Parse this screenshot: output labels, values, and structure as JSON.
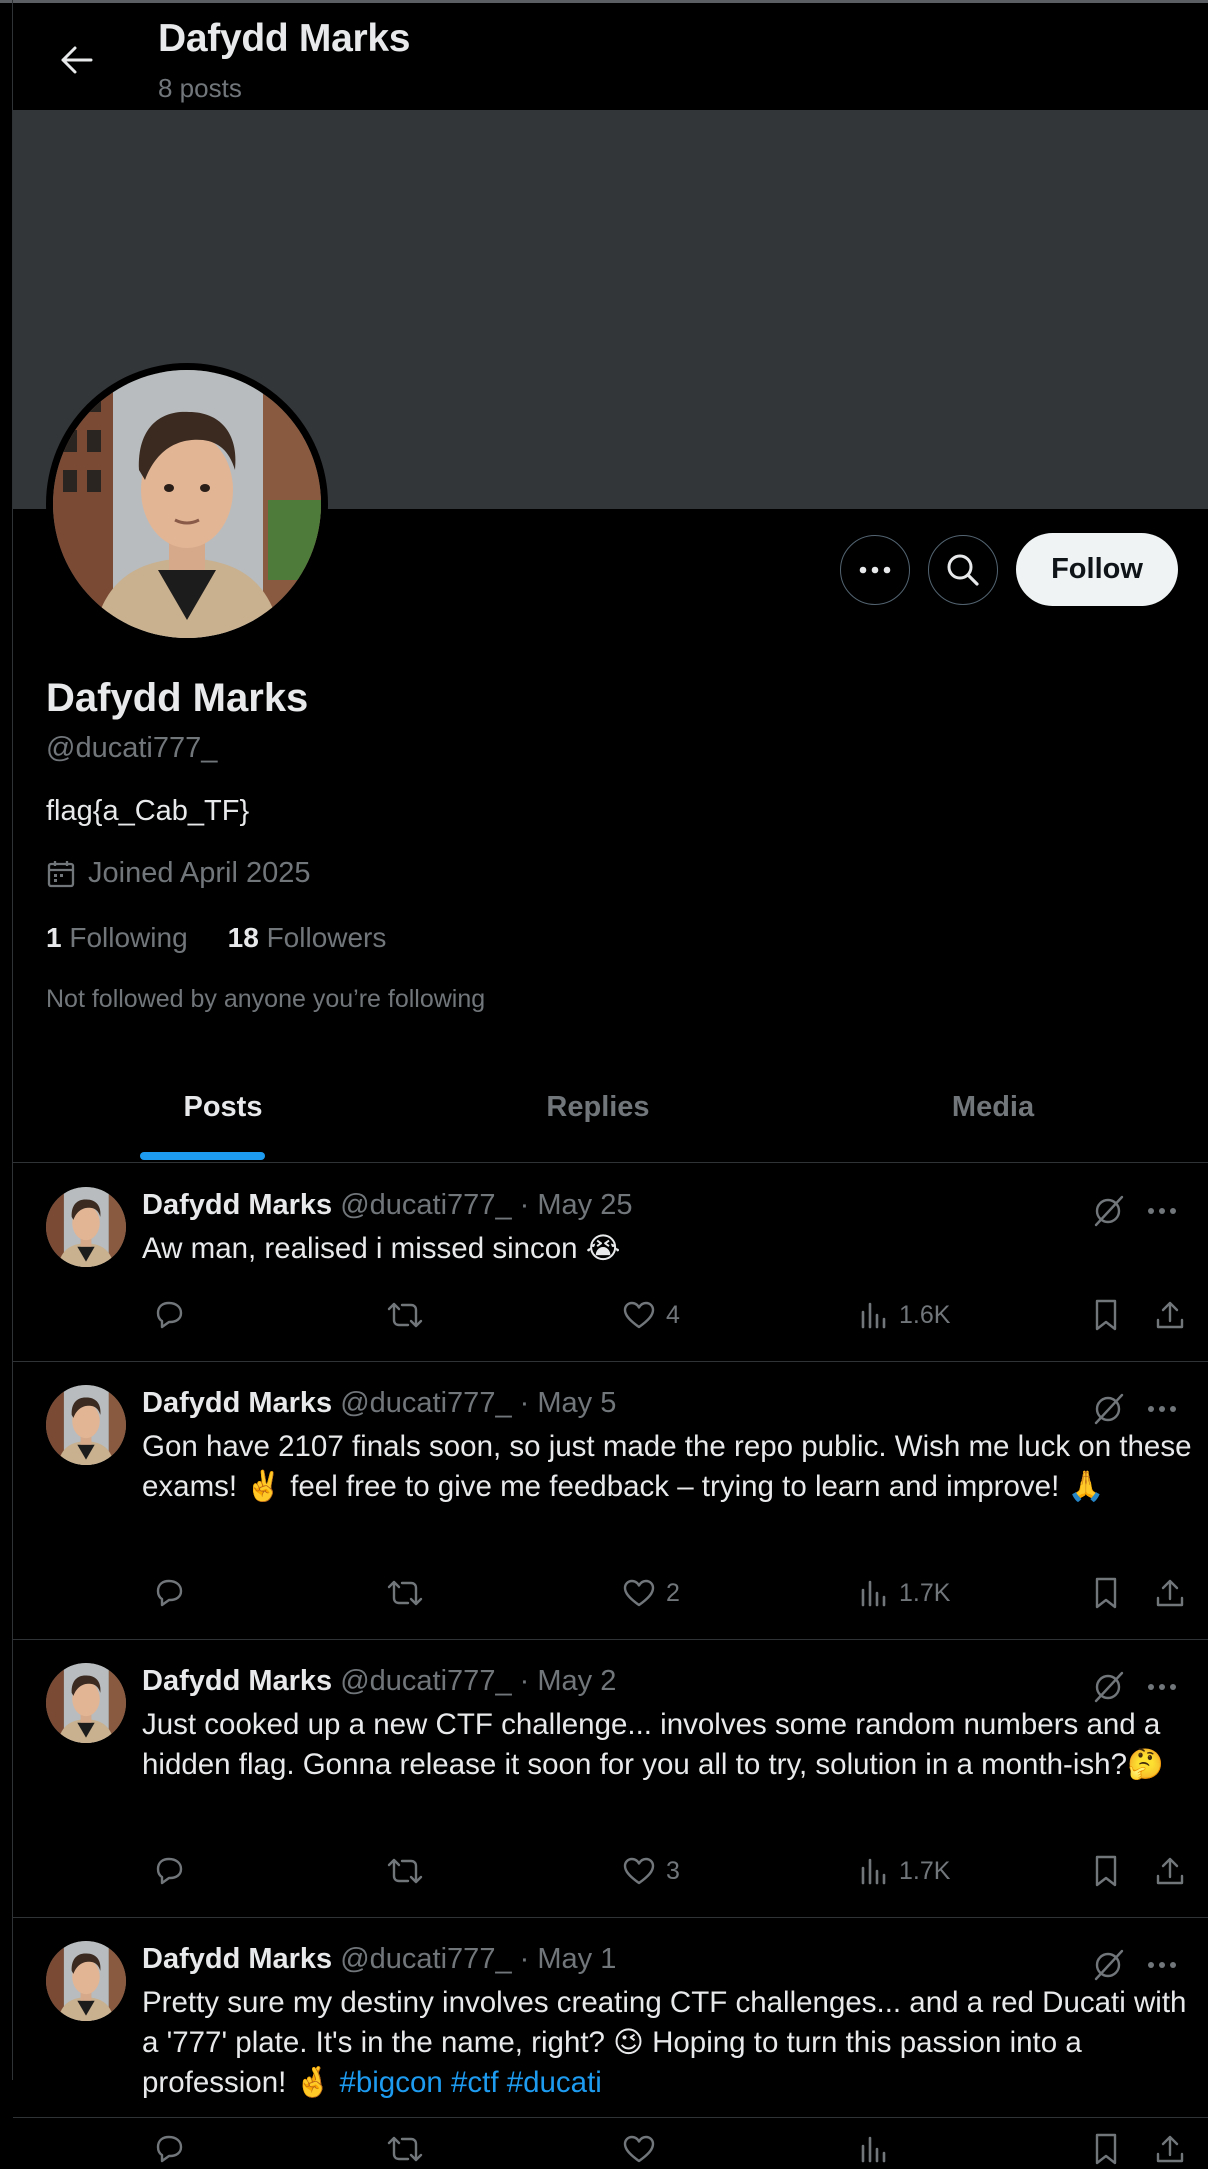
{
  "header": {
    "title": "Dafydd Marks",
    "post_count": "8 posts"
  },
  "profile": {
    "name": "Dafydd Marks",
    "handle": "@ducati777_",
    "bio": "flag{a_Cab_TF}",
    "joined": "Joined April 2025",
    "following_count": "1",
    "following_label": "Following",
    "followers_count": "18",
    "followers_label": "Followers",
    "note": "Not followed by anyone you’re following",
    "follow_label": "Follow"
  },
  "tabs": [
    {
      "label": "Posts",
      "active": true
    },
    {
      "label": "Replies",
      "active": false
    },
    {
      "label": "Media",
      "active": false
    }
  ],
  "posts": [
    {
      "name": "Dafydd Marks",
      "handle": "@ducati777_",
      "date": "May 25",
      "text": "Aw man, realised i missed sincon 😭",
      "replies": "",
      "reposts": "",
      "likes": "4",
      "views": "1.6K"
    },
    {
      "name": "Dafydd Marks",
      "handle": "@ducati777_",
      "date": "May 5",
      "text": "Gon have 2107 finals soon, so just made the repo public. Wish me luck on these exams! ✌️ feel free to give me feedback – trying to learn and improve! 🙏",
      "replies": "",
      "reposts": "",
      "likes": "2",
      "views": "1.7K"
    },
    {
      "name": "Dafydd Marks",
      "handle": "@ducati777_",
      "date": "May 2",
      "text": "Just cooked up a new CTF challenge... involves some random numbers and a hidden flag. Gonna release it soon for you all to try, solution in a month-ish?🤔",
      "replies": "",
      "reposts": "",
      "likes": "3",
      "views": "1.7K"
    },
    {
      "name": "Dafydd Marks",
      "handle": "@ducati777_",
      "date": "May 1",
      "text": "Pretty sure my destiny involves creating CTF challenges... and a red Ducati with a '777' plate. It's in the name, right? 😉 Hoping to turn this passion into",
      "text_tail": "a profession! 🤞",
      "hashtags": "#bigcon #ctf #ducati",
      "replies": "",
      "reposts": "",
      "likes": "",
      "views": ""
    }
  ],
  "colors": {
    "background": "#000000",
    "banner": "#333639",
    "accent": "#1d9bf0",
    "muted": "#71767b",
    "text": "#e7e9ea"
  },
  "icons": [
    "back-arrow-icon",
    "more-icon",
    "search-icon",
    "calendar-icon",
    "grok-icon",
    "reply-icon",
    "repost-icon",
    "like-icon",
    "views-icon",
    "bookmark-icon",
    "share-icon"
  ]
}
